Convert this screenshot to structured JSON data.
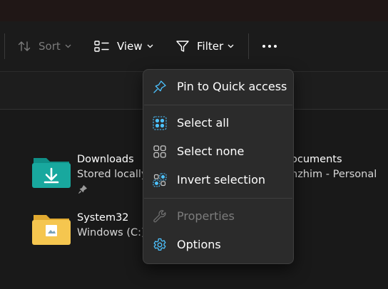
{
  "toolbar": {
    "sort_label": "Sort",
    "view_label": "View",
    "filter_label": "Filter"
  },
  "files": [
    {
      "name": "Downloads",
      "subtitle": "Stored locally",
      "icon": "downloads-folder-icon",
      "pinned": true
    },
    {
      "name": "System32",
      "subtitle": "Windows (C:)\\",
      "icon": "folder-icon"
    },
    {
      "name": "ocuments",
      "subtitle": "nzhim - Personal",
      "icon": "documents-folder-icon"
    }
  ],
  "menu": {
    "items": [
      {
        "label": "Pin to Quick access",
        "icon": "pin-icon",
        "enabled": true
      },
      {
        "label": "Select all",
        "icon": "select-all-icon",
        "enabled": true
      },
      {
        "label": "Select none",
        "icon": "select-none-icon",
        "enabled": true
      },
      {
        "label": "Invert selection",
        "icon": "invert-selection-icon",
        "enabled": true
      },
      {
        "label": "Properties",
        "icon": "wrench-icon",
        "enabled": false
      },
      {
        "label": "Options",
        "icon": "gear-icon",
        "enabled": true
      }
    ]
  },
  "colors": {
    "accent": "#4cc2ff",
    "folder_teal": "#16a39a",
    "folder_yellow": "#f3c64a",
    "menu_bg": "#2b2b2b"
  }
}
